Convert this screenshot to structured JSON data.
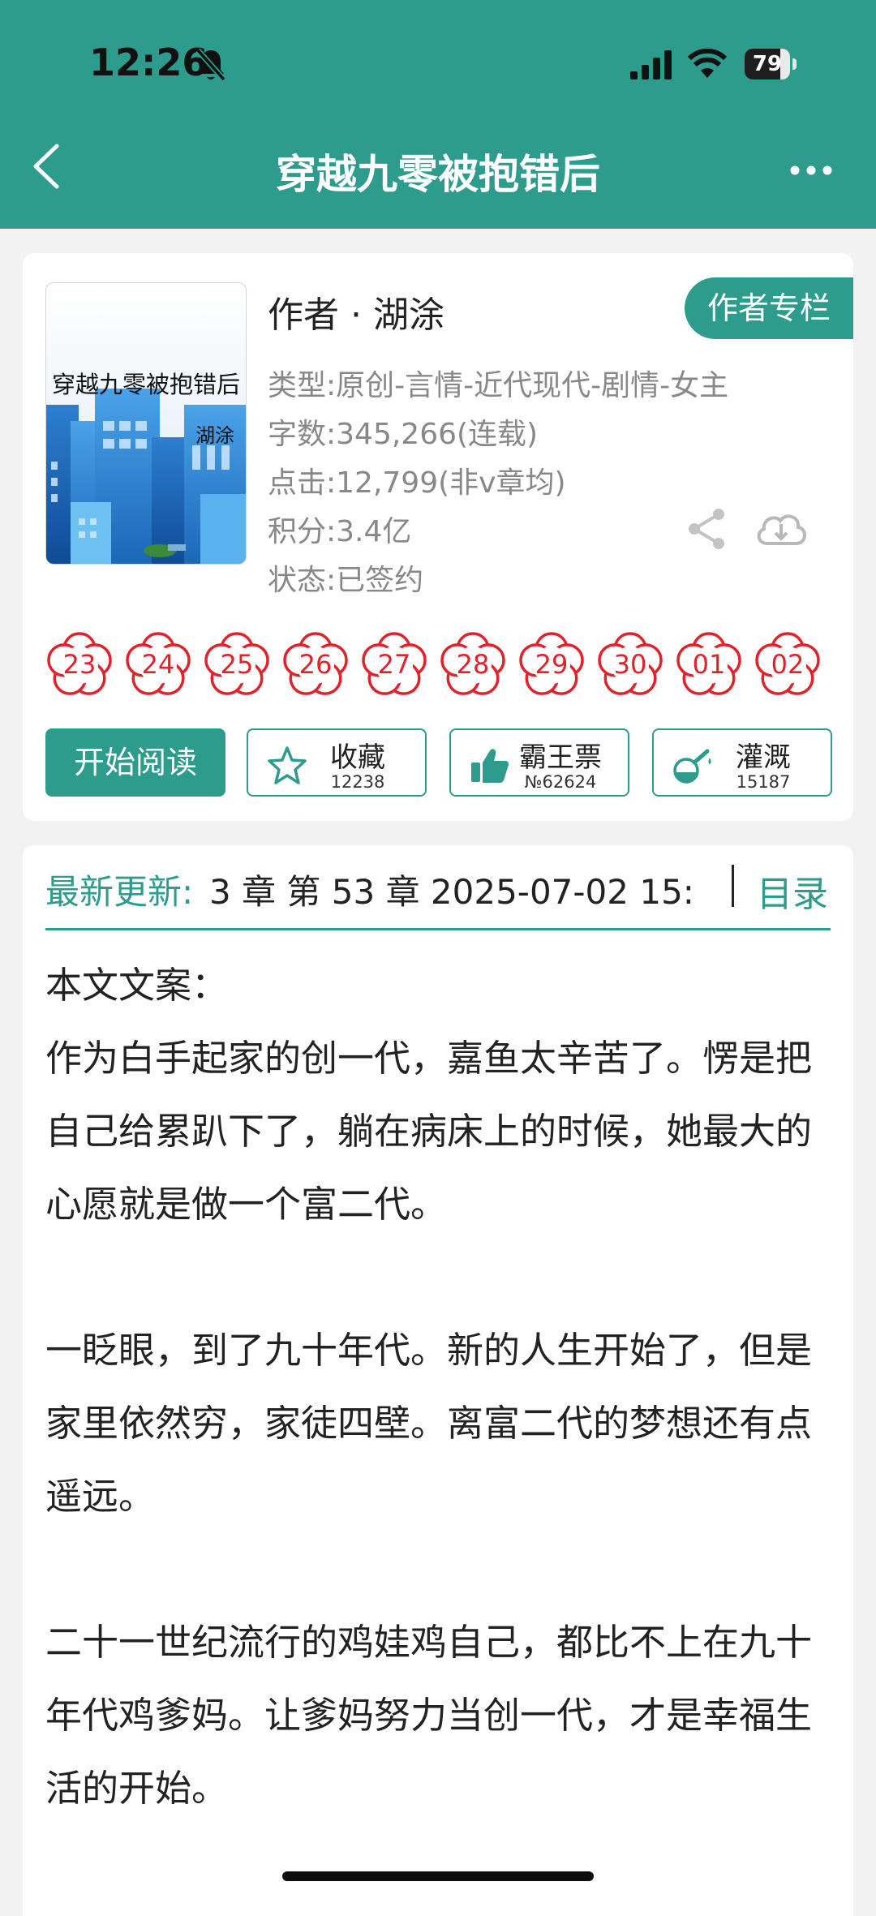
{
  "status_bar": {
    "time": "12:26",
    "battery": "79",
    "battery_level": 0.79
  },
  "header": {
    "title": "穿越九零被抱错后"
  },
  "book": {
    "cover_title": "穿越九零被抱错后",
    "cover_author": "湖涂",
    "author_line": "作者 · 湖涂",
    "author_column_button": "作者专栏",
    "meta": [
      "类型:原创-言情-近代现代-剧情-女主",
      "字数:345,266(连载)",
      "点击:12,799(非v章均)",
      "积分:3.4亿",
      "状态:已签约"
    ],
    "flower_days": [
      "23",
      "24",
      "25",
      "26",
      "27",
      "28",
      "29",
      "30",
      "01",
      "02"
    ]
  },
  "actions": {
    "start_reading": "开始阅读",
    "favorite": {
      "label": "收藏",
      "count": "12238"
    },
    "overlord_ticket": {
      "label": "霸王票",
      "count": "№62624"
    },
    "irrigate": {
      "label": "灌溉",
      "count": "15187"
    }
  },
  "latest": {
    "label": "最新更新:",
    "value": "3 章 第 53 章 2025-07-02 15:",
    "toc": "目录"
  },
  "synopsis": [
    "本文文案：",
    "作为白手起家的创一代，嘉鱼太辛苦了。愣是把自己给累趴下了，躺在病床上的时候，她最大的心愿就是做一个富二代。",
    "",
    "一眨眼，到了九十年代。新的人生开始了，但是家里依然穷，家徒四壁。离富二代的梦想还有点遥远。",
    "",
    "二十一世纪流行的鸡娃鸡自己，都比不上在九十年代鸡爹妈。让爹妈努力当创一代，才是幸福生活的开始。"
  ],
  "colors": {
    "accent": "#2e9c8c",
    "flower": "#e0232b"
  }
}
